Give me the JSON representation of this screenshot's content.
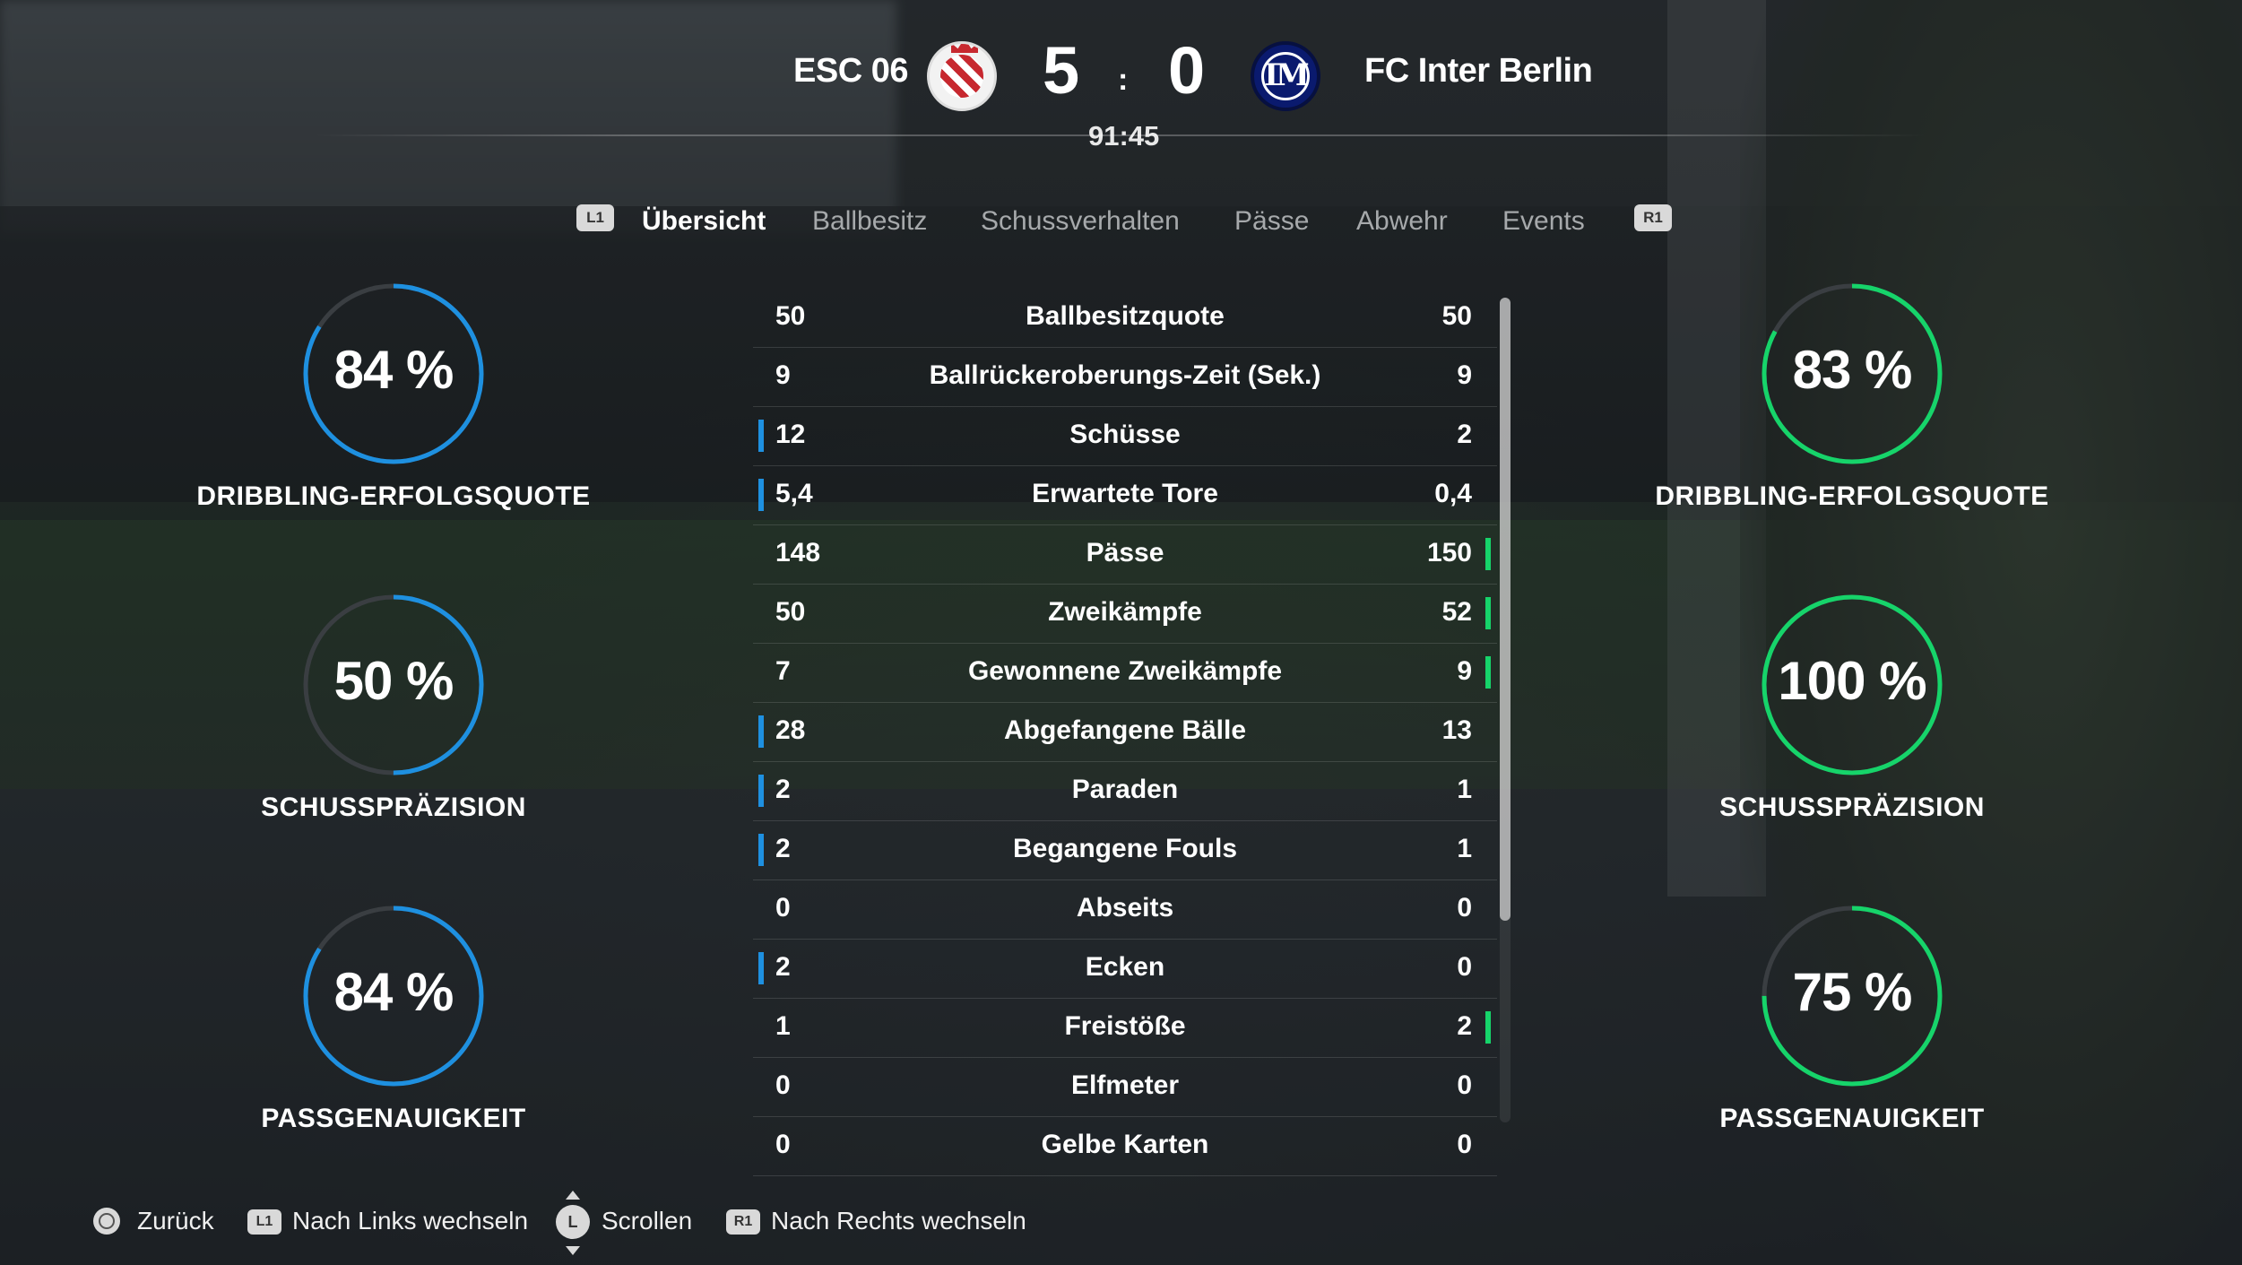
{
  "colors": {
    "home_accent": "#1e90e0",
    "away_accent": "#16d46a",
    "ring_track": "#3a3e42"
  },
  "header": {
    "home_team": "ESC 06",
    "away_team": "FC Inter Berlin",
    "home_score": "5",
    "away_score": "0",
    "separator": ":",
    "time": "91:45",
    "home_crest_icon": "esc06-crest-icon",
    "away_crest_icon": "inter-crest-icon",
    "away_crest_text": "IM"
  },
  "tabs": {
    "prev_button": "L1",
    "next_button": "R1",
    "items": [
      {
        "label": "Übersicht",
        "active": true
      },
      {
        "label": "Ballbesitz",
        "active": false
      },
      {
        "label": "Schussverhalten",
        "active": false
      },
      {
        "label": "Pässe",
        "active": false
      },
      {
        "label": "Abwehr",
        "active": false
      },
      {
        "label": "Events",
        "active": false
      }
    ]
  },
  "home_rings": [
    {
      "pct_text": "84 %",
      "value": 0.84,
      "label": "DRIBBLING-ERFOLGSQUOTE"
    },
    {
      "pct_text": "50 %",
      "value": 0.5,
      "label": "SCHUSSPRÄZISION"
    },
    {
      "pct_text": "84 %",
      "value": 0.84,
      "label": "PASSGENAUIGKEIT"
    }
  ],
  "away_rings": [
    {
      "pct_text": "83 %",
      "value": 0.83,
      "label": "DRIBBLING-ERFOLGSQUOTE"
    },
    {
      "pct_text": "100 %",
      "value": 1.0,
      "label": "SCHUSSPRÄZISION"
    },
    {
      "pct_text": "75 %",
      "value": 0.75,
      "label": "PASSGENAUIGKEIT"
    }
  ],
  "stats": [
    {
      "home": "50",
      "label": "Ballbesitzquote",
      "away": "50",
      "lead": ""
    },
    {
      "home": "9",
      "label": "Ballrückeroberungs-Zeit (Sek.)",
      "away": "9",
      "lead": ""
    },
    {
      "home": "12",
      "label": "Schüsse",
      "away": "2",
      "lead": "home"
    },
    {
      "home": "5,4",
      "label": "Erwartete Tore",
      "away": "0,4",
      "lead": "home"
    },
    {
      "home": "148",
      "label": "Pässe",
      "away": "150",
      "lead": "away"
    },
    {
      "home": "50",
      "label": "Zweikämpfe",
      "away": "52",
      "lead": "away"
    },
    {
      "home": "7",
      "label": "Gewonnene Zweikämpfe",
      "away": "9",
      "lead": "away"
    },
    {
      "home": "28",
      "label": "Abgefangene Bälle",
      "away": "13",
      "lead": "home"
    },
    {
      "home": "2",
      "label": "Paraden",
      "away": "1",
      "lead": "home"
    },
    {
      "home": "2",
      "label": "Begangene Fouls",
      "away": "1",
      "lead": "home"
    },
    {
      "home": "0",
      "label": "Abseits",
      "away": "0",
      "lead": ""
    },
    {
      "home": "2",
      "label": "Ecken",
      "away": "0",
      "lead": "home"
    },
    {
      "home": "1",
      "label": "Freistöße",
      "away": "2",
      "lead": "away"
    },
    {
      "home": "0",
      "label": "Elfmeter",
      "away": "0",
      "lead": ""
    },
    {
      "home": "0",
      "label": "Gelbe Karten",
      "away": "0",
      "lead": ""
    }
  ],
  "footer": {
    "back_icon": "circle-button-icon",
    "back_label": "Zurück",
    "left_button": "L1",
    "left_label": "Nach Links wechseln",
    "scroll_button": "L",
    "scroll_label": "Scrollen",
    "right_button": "R1",
    "right_label": "Nach Rechts wechseln"
  }
}
